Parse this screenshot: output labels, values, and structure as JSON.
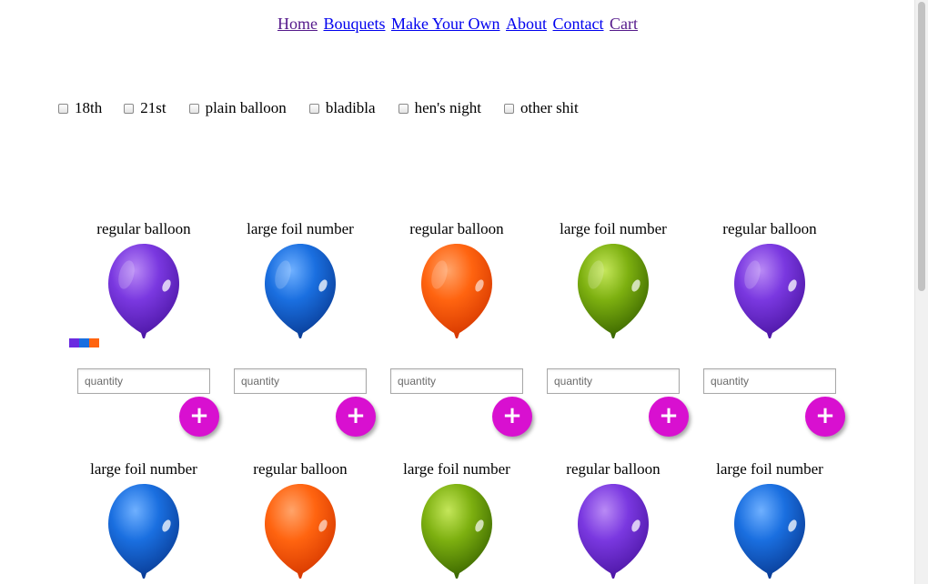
{
  "nav": {
    "links": [
      {
        "label": "Home",
        "visited": true
      },
      {
        "label": "Bouquets",
        "visited": false
      },
      {
        "label": "Make Your Own",
        "visited": false
      },
      {
        "label": "About",
        "visited": false
      },
      {
        "label": "Contact",
        "visited": false
      },
      {
        "label": "Cart",
        "visited": true
      }
    ]
  },
  "filters": [
    {
      "label": "18th",
      "checked": false
    },
    {
      "label": "21st",
      "checked": false
    },
    {
      "label": "plain balloon",
      "checked": false
    },
    {
      "label": "bladibla",
      "checked": false
    },
    {
      "label": "hen's night",
      "checked": false
    },
    {
      "label": "other shit",
      "checked": false
    }
  ],
  "colors": {
    "purple": "#7a38e0",
    "blue": "#1a6fe0",
    "orange": "#ff6410",
    "green": "#7db010",
    "add_button": "#d810d0"
  },
  "swatches": [
    "#6a2be0",
    "#1a6fe0",
    "#ff6410"
  ],
  "products": [
    {
      "name": "regular balloon",
      "color": "purple",
      "placeholder": "quantity",
      "add_label": "+"
    },
    {
      "name": "large foil number",
      "color": "blue",
      "placeholder": "quantity",
      "add_label": "+"
    },
    {
      "name": "regular balloon",
      "color": "orange",
      "placeholder": "quantity",
      "add_label": "+"
    },
    {
      "name": "large foil number",
      "color": "green",
      "placeholder": "quantity",
      "add_label": "+"
    },
    {
      "name": "regular balloon",
      "color": "purple",
      "placeholder": "quantity",
      "add_label": "+"
    },
    {
      "name": "large foil number",
      "color": "blue"
    },
    {
      "name": "regular balloon",
      "color": "orange"
    },
    {
      "name": "large foil number",
      "color": "green"
    },
    {
      "name": "regular balloon",
      "color": "purple"
    },
    {
      "name": "large foil number",
      "color": "blue"
    }
  ]
}
